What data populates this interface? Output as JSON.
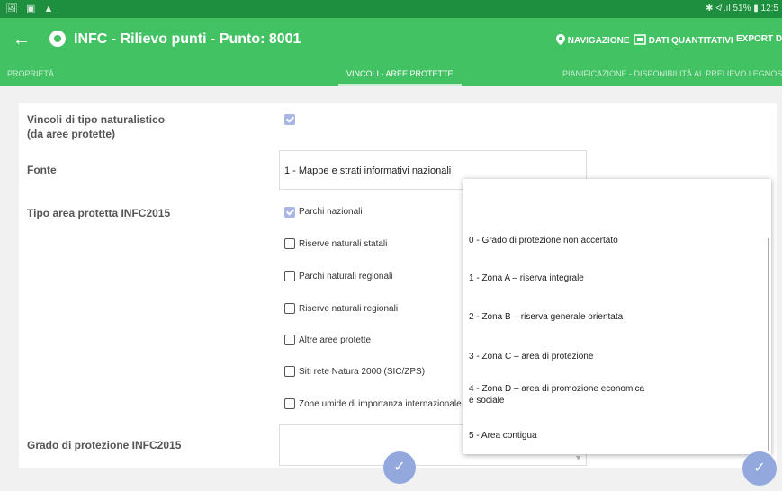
{
  "statusbar": {
    "left_icons": "🖼 ▣ ▲",
    "right_text": "✱ ≮ .ıl 51% ▮ 12:5"
  },
  "appbar": {
    "back": "←",
    "title": "INFC - Rilievo punti - Punto: 8001",
    "nav_label": "NAVIGAZIONE",
    "dati_label": "DATI QUANTITATIVI",
    "export_label": "EXPORT DB"
  },
  "tabs": {
    "proprieta": "PROPRIETÀ",
    "vincoli": "VINCOLI - AREE PROTETTE",
    "pianificazione": "PIANIFICAZIONE - DISPONIBILITÀ AL PRELIEVO LEGNOSO"
  },
  "form": {
    "vincoli_label_1": "Vincoli di tipo naturalistico",
    "vincoli_label_2": "(da aree protette)",
    "fonte_label": "Fonte",
    "fonte_value": "1 - Mappe e strati informativi nazionali",
    "tipo_label": "Tipo area protetta INFC2015",
    "grado_label": "Grado di protezione INFC2015",
    "checkboxes": [
      {
        "label": "Parchi nazionali",
        "checked": true
      },
      {
        "label": "Riserve naturali statali",
        "checked": false
      },
      {
        "label": "Parchi naturali regionali",
        "checked": false
      },
      {
        "label": "Riserve naturali regionali",
        "checked": false
      },
      {
        "label": "Altre aree protette",
        "checked": false
      },
      {
        "label": "Siti rete Natura 2000 (SIC/ZPS)",
        "checked": false
      },
      {
        "label": "Zone umide di importanza internazionale",
        "checked": false
      }
    ]
  },
  "dropdown": {
    "items": [
      "0 - Grado di protezione non accertato",
      "1 - Zona A – riserva integrale",
      "2 - Zona B – riserva generale orientata",
      "3 - Zona C – area di protezione",
      "4 - Zona D – area di promozione economica e sociale",
      "5 - Area contigua"
    ]
  },
  "fab": {
    "check": "✓"
  }
}
